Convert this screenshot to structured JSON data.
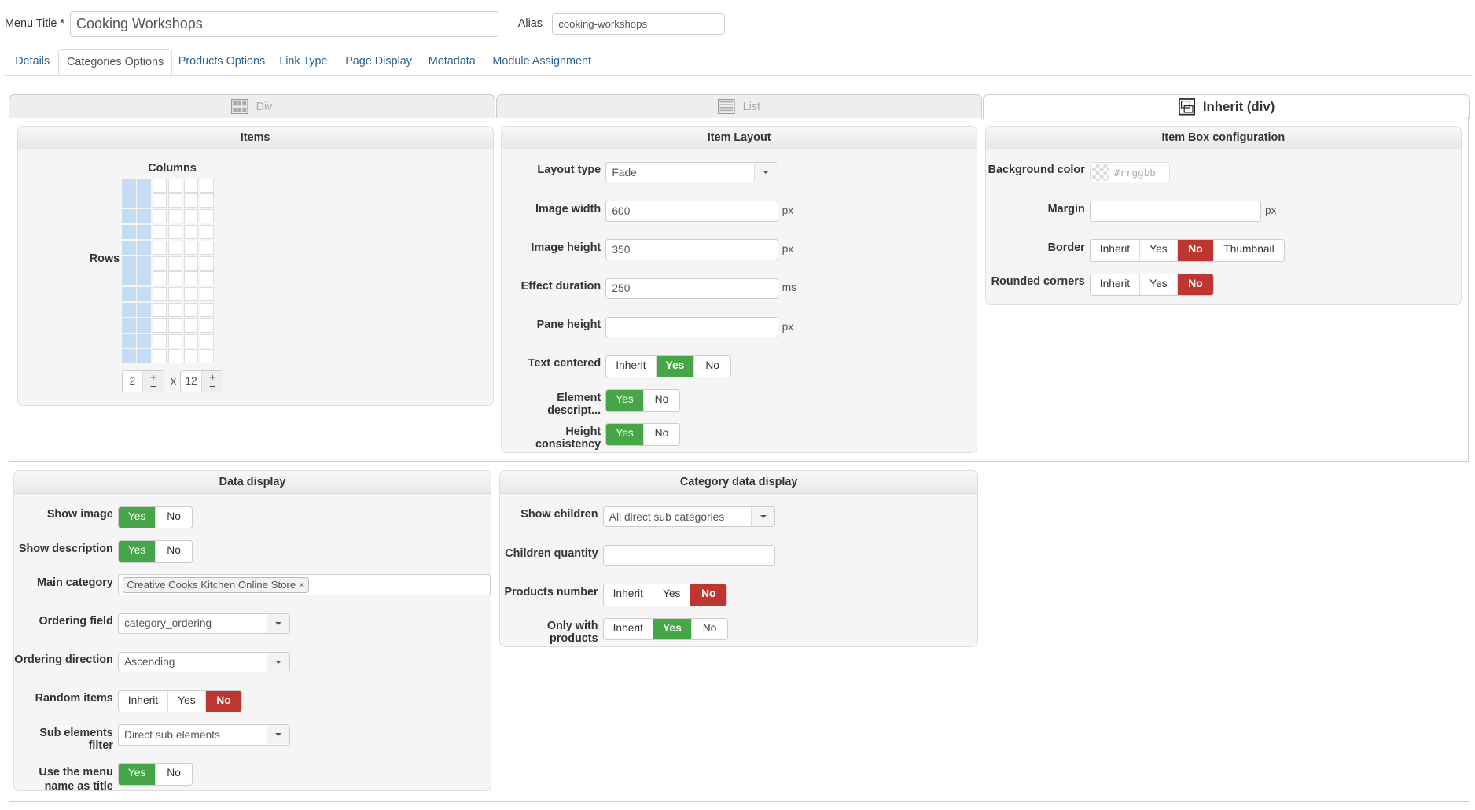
{
  "header": {
    "menu_title_label": "Menu Title *",
    "menu_title_value": "Cooking Workshops",
    "alias_label": "Alias",
    "alias_value": "cooking-workshops"
  },
  "tabs": [
    {
      "label": "Details",
      "active": false
    },
    {
      "label": "Categories Options",
      "active": true
    },
    {
      "label": "Products Options",
      "active": false
    },
    {
      "label": "Link Type",
      "active": false
    },
    {
      "label": "Page Display",
      "active": false
    },
    {
      "label": "Metadata",
      "active": false
    },
    {
      "label": "Module Assignment",
      "active": false
    }
  ],
  "layout_tabs": [
    {
      "label": "Div",
      "icon": "grid-icon",
      "active": false
    },
    {
      "label": "List",
      "icon": "list-icon",
      "active": false
    },
    {
      "label": "Inherit (div)",
      "icon": "inherit-icon",
      "active": true
    }
  ],
  "colors": {
    "yes": "#46a546",
    "no": "#bd362f",
    "grid_selected": "#c6dcf2"
  },
  "items": {
    "title": "Items",
    "columns_label": "Columns",
    "rows_label": "Rows",
    "columns": 2,
    "rows": 12,
    "columns_value": "2",
    "rows_value": "12",
    "times": "x",
    "plus": "+",
    "minus": "−"
  },
  "item_layout": {
    "title": "Item Layout",
    "rows": [
      {
        "label": "Layout type",
        "type": "select",
        "value": "Fade"
      },
      {
        "label": "Image width",
        "type": "input",
        "value": "600",
        "unit": "px"
      },
      {
        "label": "Image height",
        "type": "input",
        "value": "350",
        "unit": "px"
      },
      {
        "label": "Effect duration",
        "type": "input",
        "value": "250",
        "unit": "ms"
      },
      {
        "label": "Pane height",
        "type": "input",
        "value": "",
        "unit": "px"
      },
      {
        "label": "Text centered",
        "type": "toggle",
        "options": [
          "Inherit",
          "Yes",
          "No"
        ],
        "selected": "Yes"
      },
      {
        "label": "Element descript...",
        "type": "toggle",
        "options": [
          "Yes",
          "No"
        ],
        "selected": "Yes"
      },
      {
        "label": "Height consistency",
        "type": "toggle",
        "options": [
          "Yes",
          "No"
        ],
        "selected": "Yes"
      }
    ]
  },
  "item_box": {
    "title": "Item Box configuration",
    "rows": [
      {
        "label": "Background color",
        "type": "color",
        "placeholder": "#rrggbb"
      },
      {
        "label": "Margin",
        "type": "input",
        "value": "",
        "unit": "px"
      },
      {
        "label": "Border",
        "type": "toggle",
        "options": [
          "Inherit",
          "Yes",
          "No",
          "Thumbnail"
        ],
        "selected": "No"
      },
      {
        "label": "Rounded corners",
        "type": "toggle",
        "options": [
          "Inherit",
          "Yes",
          "No"
        ],
        "selected": "No"
      }
    ]
  },
  "data_display": {
    "title": "Data display",
    "rows": [
      {
        "label": "Show image",
        "type": "toggle",
        "options": [
          "Yes",
          "No"
        ],
        "selected": "Yes"
      },
      {
        "label": "Show description",
        "type": "toggle",
        "options": [
          "Yes",
          "No"
        ],
        "selected": "Yes"
      },
      {
        "label": "Main category",
        "type": "tags",
        "tags": [
          "Creative Cooks Kitchen Online Store"
        ],
        "remove": "×"
      },
      {
        "label": "Ordering field",
        "type": "select",
        "value": "category_ordering"
      },
      {
        "label": "Ordering direction",
        "type": "select",
        "value": "Ascending"
      },
      {
        "label": "Random items",
        "type": "toggle",
        "options": [
          "Inherit",
          "Yes",
          "No"
        ],
        "selected": "No"
      },
      {
        "label": "Sub elements filter",
        "type": "select",
        "value": "Direct sub elements"
      },
      {
        "label": "Use the menu name as title",
        "type": "toggle",
        "options": [
          "Yes",
          "No"
        ],
        "selected": "Yes",
        "wrap": true
      }
    ]
  },
  "category_display": {
    "title": "Category data display",
    "rows": [
      {
        "label": "Show children",
        "type": "select",
        "value": "All direct sub categories"
      },
      {
        "label": "Children quantity",
        "type": "input",
        "value": ""
      },
      {
        "label": "Products number",
        "type": "toggle",
        "options": [
          "Inherit",
          "Yes",
          "No"
        ],
        "selected": "No"
      },
      {
        "label": "Only with products",
        "type": "toggle",
        "options": [
          "Inherit",
          "Yes",
          "No"
        ],
        "selected": "Yes"
      }
    ]
  }
}
